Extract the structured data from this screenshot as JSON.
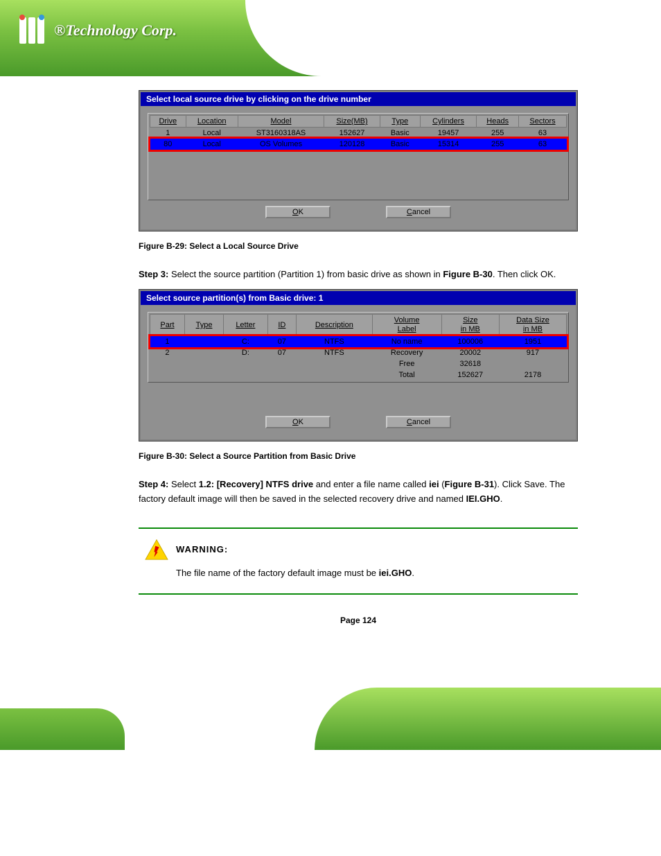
{
  "header": {
    "brand": "®Technology Corp."
  },
  "dialog1": {
    "title": "Select local source drive by clicking on the drive number",
    "columns": [
      "Drive",
      "Location",
      "Model",
      "Size(MB)",
      "Type",
      "Cylinders",
      "Heads",
      "Sectors"
    ],
    "rows": [
      {
        "cells": [
          "1",
          "Local",
          "ST3160318AS",
          "152627",
          "Basic",
          "19457",
          "255",
          "63"
        ],
        "highlight": false
      },
      {
        "cells": [
          "80",
          "Local",
          "OS Volumes",
          "120128",
          "Basic",
          "15314",
          "255",
          "63"
        ],
        "highlight": true
      }
    ],
    "ok": "OK",
    "cancel": "Cancel"
  },
  "caption1": "Figure B-29: Select a Local Source Drive",
  "step3": {
    "num": "Step 3:",
    "text_a": "Select the source partition (Partition 1) from basic drive as shown in",
    "ref": "Figure B-30",
    "text_b": ". Then click OK."
  },
  "dialog2": {
    "title": "Select source partition(s) from Basic drive: 1",
    "columns": [
      "Part",
      "Type",
      "Letter",
      "ID",
      "Description",
      "Volume\nLabel",
      "Size\nin MB",
      "Data Size\nin MB"
    ],
    "rows": [
      {
        "cells": [
          "1",
          "",
          "C:",
          "07",
          "NTFS",
          "No name",
          "100006",
          "1951"
        ],
        "highlight": true
      },
      {
        "cells": [
          "2",
          "",
          "D:",
          "07",
          "NTFS",
          "Recovery",
          "20002",
          "917"
        ],
        "highlight": false
      },
      {
        "cells": [
          "",
          "",
          "",
          "",
          "",
          "Free",
          "32618",
          ""
        ],
        "highlight": false
      }
    ],
    "total": {
      "label": "Total",
      "size": "152627",
      "data": "2178"
    },
    "ok": "OK",
    "cancel": "Cancel"
  },
  "caption2": "Figure B-30: Select a Source Partition from Basic Drive",
  "step4": {
    "num": "Step 4:",
    "text_a": "Select ",
    "bold": "1.2: [Recovery] NTFS drive",
    "text_b": " and enter a file name called ",
    "bold2": "iei",
    "text_c": " (",
    "ref": "Figure B-31",
    "text_d": "). Click ",
    "save": "Save",
    "text_e": ". The factory default image will then be saved in the selected recovery drive and named ",
    "bold3": "IEI.GHO",
    "text_f": "."
  },
  "warning": {
    "title": "WARNING:",
    "text": "The file name of the factory default image must be ",
    "bold": "iei.GHO",
    "text2": "."
  },
  "page_num": "Page 124"
}
